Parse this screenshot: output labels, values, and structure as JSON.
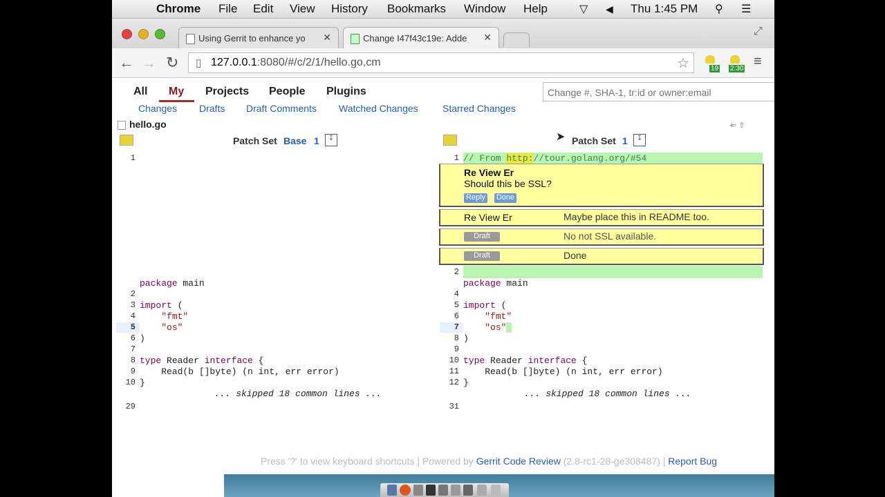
{
  "menubar": {
    "app": "Chrome",
    "items": [
      "File",
      "Edit",
      "View",
      "History",
      "Bookmarks",
      "Window",
      "Help"
    ],
    "clock": "Thu 1:45 PM"
  },
  "browser": {
    "tabs": [
      {
        "title": "Using Gerrit to enhance yo"
      },
      {
        "title": "Change I47f43c19e: Adde"
      }
    ],
    "url_host": "127.0.0.1",
    "url_rest": ":8080/#/c/2/1/hello.go,cm",
    "ext_badge_1": "19",
    "ext_badge_2": "2:30"
  },
  "gerrit": {
    "nav": [
      "All",
      "My",
      "Projects",
      "People",
      "Plugins"
    ],
    "subnav": [
      "Changes",
      "Drafts",
      "Draft Comments",
      "Watched Changes",
      "Starred Changes"
    ],
    "search_placeholder": "Change #, SHA-1, tr:id or owner:email",
    "file_name": "hello.go",
    "left_header": {
      "label": "Patch Set",
      "base": "Base",
      "num": "1"
    },
    "right_header": {
      "label": "Patch Set",
      "num": "1"
    },
    "comment_line": "// From http://tour.golang.org/#54",
    "comment_author": "Re View Er",
    "comment_text": "Should this be SSL?",
    "reply_label": "Reply",
    "done_label": "Done",
    "reply_author": "Re View Er",
    "reply_text": "Maybe place this in README too.",
    "draft_label": "Draft",
    "draft1_text": "No not SSL available.",
    "draft2_text": "Done",
    "skipped_text": "... skipped 18 common lines ...",
    "left_last_line": "29",
    "right_last_line": "31",
    "footer_prefix": "Press '?' to view keyboard shortcuts | Powered by",
    "footer_product": "Gerrit Code Review",
    "footer_version": "(2.8-rc1-28-ge308487)",
    "footer_sep": "|",
    "footer_bug": "Report Bug"
  },
  "colors": {
    "link": "#2a5db0",
    "comment_bg": "#ffffa0",
    "insert_bg": "#b9f4b0"
  }
}
